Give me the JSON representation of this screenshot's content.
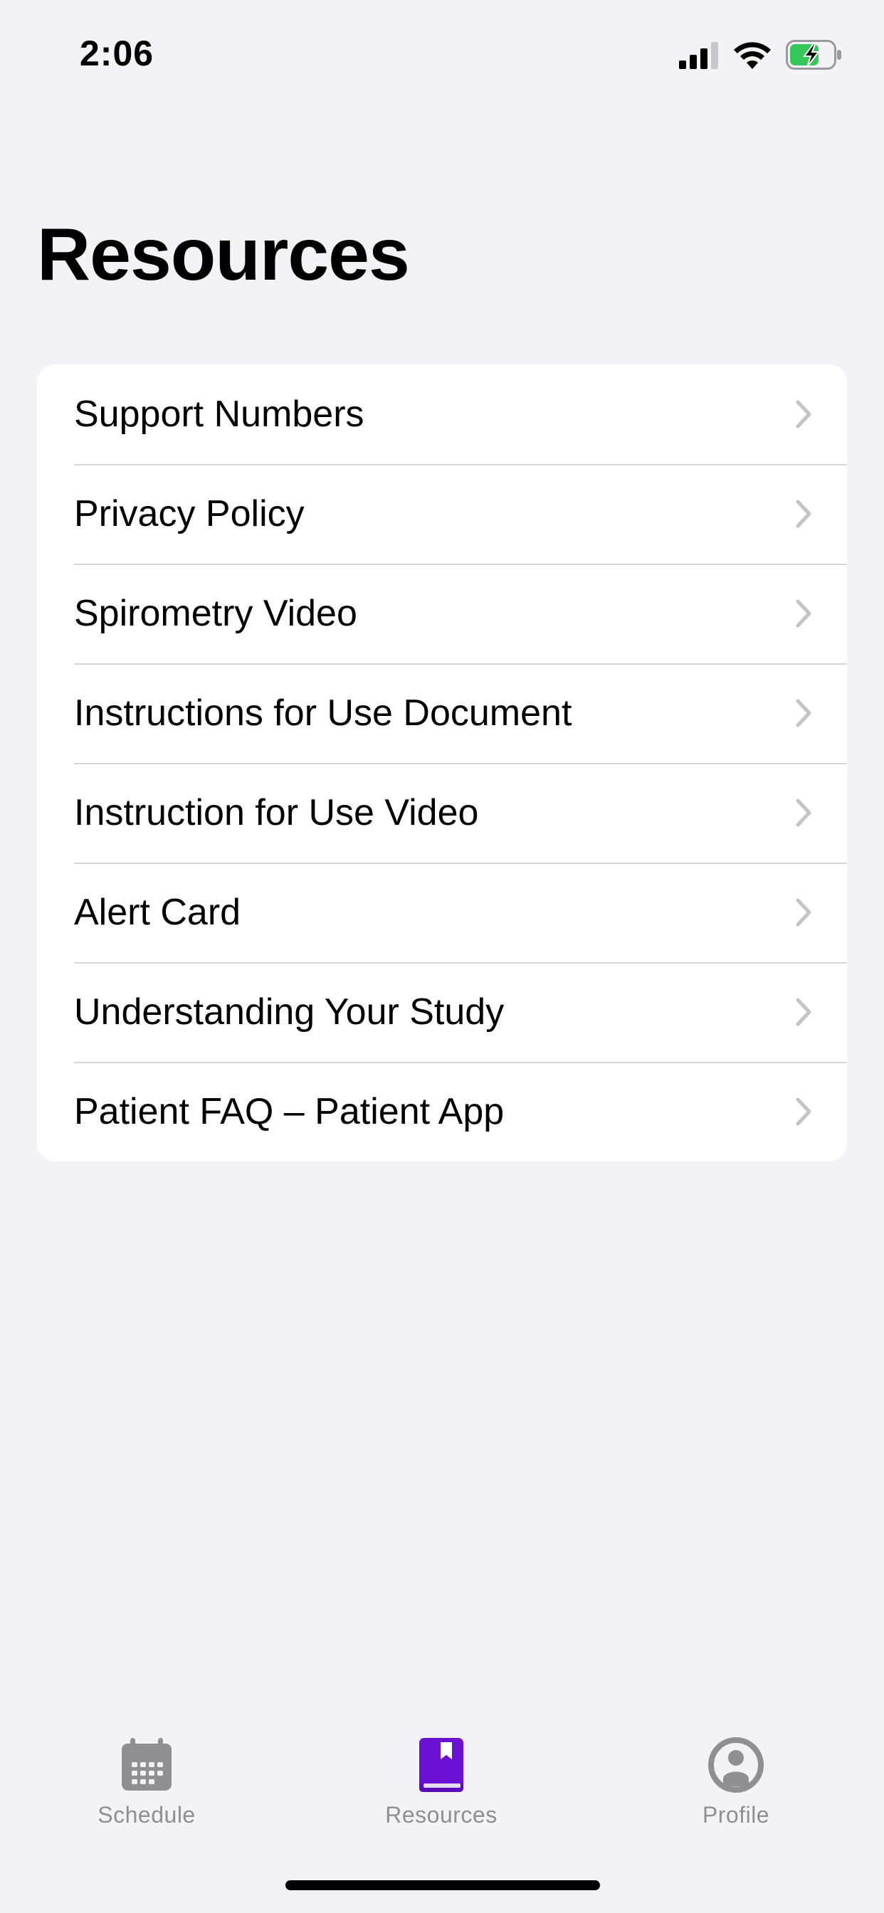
{
  "status_bar": {
    "time": "2:06",
    "icons": [
      "signal-icon",
      "wifi-icon",
      "battery-charging-icon"
    ]
  },
  "page": {
    "title": "Resources"
  },
  "resources": {
    "items": [
      {
        "label": "Support Numbers"
      },
      {
        "label": "Privacy Policy"
      },
      {
        "label": "Spirometry Video"
      },
      {
        "label": "Instructions for Use Document"
      },
      {
        "label": "Instruction for Use Video"
      },
      {
        "label": "Alert Card"
      },
      {
        "label": "Understanding Your Study"
      },
      {
        "label": "Patient FAQ – Patient App"
      }
    ]
  },
  "tab_bar": {
    "tabs": [
      {
        "label": "Schedule",
        "icon": "calendar-icon",
        "active": false
      },
      {
        "label": "Resources",
        "icon": "book-icon",
        "active": true
      },
      {
        "label": "Profile",
        "icon": "profile-icon",
        "active": false
      }
    ]
  },
  "colors": {
    "accent": "#6a11d4",
    "battery_charge": "#34c759",
    "inactive_tab": "#8e8e93",
    "background": "#f2f2f7",
    "chevron": "#c4c4c7"
  }
}
